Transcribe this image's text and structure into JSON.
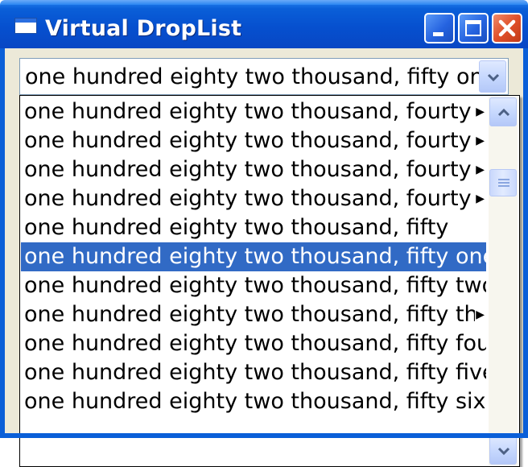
{
  "window": {
    "title": "Virtual DropList"
  },
  "combo": {
    "value": "one hundred eighty two thousand, fifty one"
  },
  "list": {
    "items": [
      "one hundred eighty two thousand, fourty s",
      "one hundred eighty two thousand, fourty s",
      "one hundred eighty two thousand, fourty e",
      "one hundred eighty two thousand, fourty n",
      "one hundred eighty two thousand, fifty",
      "one hundred eighty two thousand, fifty one",
      "one hundred eighty two thousand, fifty two",
      "one hundred eighty two thousand, fifty thre",
      "one hundred eighty two thousand, fifty four",
      "one hundred eighty two thousand, fifty five",
      "one hundred eighty two thousand, fifty six"
    ],
    "selected_index": 5
  },
  "colors": {
    "titlebar": "#0a5fd8",
    "selection": "#316ac5",
    "client_bg": "#ece9d8"
  },
  "icons": {
    "app": "window-icon",
    "minimize": "minimize-icon",
    "maximize": "maximize-icon",
    "close": "close-icon",
    "combo_arrow": "chevron-down-icon",
    "scroll_up": "chevron-up-icon",
    "scroll_down": "chevron-down-icon",
    "more": "triangle-right-icon"
  }
}
